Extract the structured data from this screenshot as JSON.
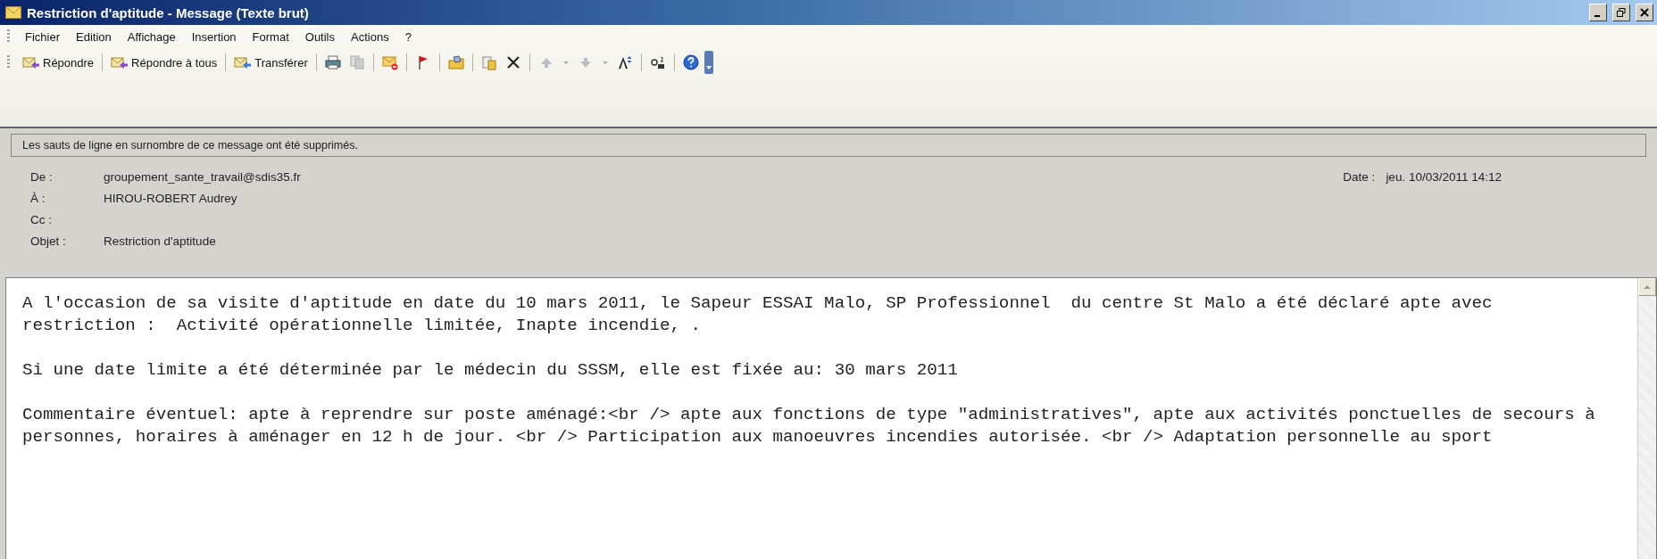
{
  "window": {
    "title": "Restriction d'aptitude - Message (Texte brut)"
  },
  "menu": [
    "Fichier",
    "Edition",
    "Affichage",
    "Insertion",
    "Format",
    "Outils",
    "Actions",
    "?"
  ],
  "toolbar": {
    "buttons": [
      "Répondre",
      "Répondre à tous",
      "Transférer"
    ]
  },
  "info_bar": "Les sauts de ligne en surnombre de ce message ont été supprimés.",
  "header": {
    "fields": [
      {
        "label": "De :",
        "value": "groupement_sante_travail@sdis35.fr"
      },
      {
        "label": "À :",
        "value": "HIROU-ROBERT Audrey"
      },
      {
        "label": "Cc :"
      },
      {
        "label": "Objet :",
        "value": "Restriction d'aptitude"
      }
    ],
    "date": {
      "label": "Date :",
      "value": "jeu. 10/03/2011 14:12"
    }
  },
  "body": {
    "paragraphs": [
      [
        "A l'occasion de sa visite d'aptitude en date du 10 mars 2011, le Sapeur ESSAI Malo, SP Professionnel  du centre St Malo a été déclaré apte avec",
        "restriction :  Activité opérationnelle limitée, Inapte incendie, ."
      ],
      [
        "Si une date limite a été déterminée par le médecin du SSSM, elle est fixée au: 30 mars 2011"
      ],
      [
        "Commentaire éventuel: apte à reprendre sur poste aménagé:<br /> apte aux fonctions de type \"administratives\", apte aux activités ponctuelles de secours à",
        "personnes, horaires à aménager en 12 h de jour. <br /> Participation aux manoeuvres incendies autorisée. <br /> Adaptation personnelle au sport"
      ]
    ]
  }
}
